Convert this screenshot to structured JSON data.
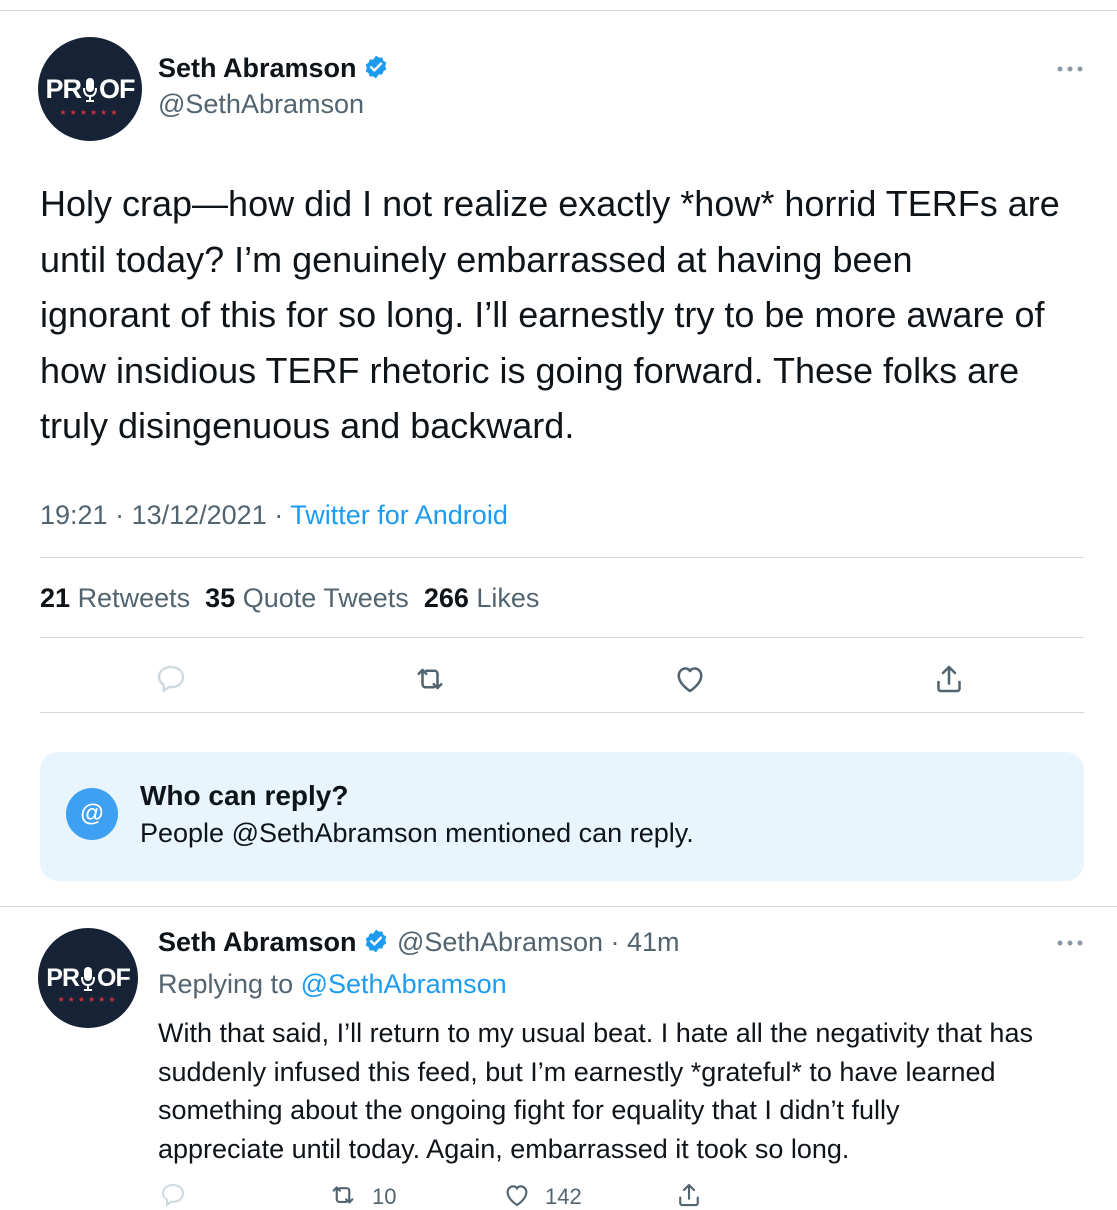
{
  "tweet": {
    "avatar_text": "PR  OF",
    "author_name": "Seth Abramson",
    "author_handle": "@SethAbramson",
    "body_lines": [
      "Holy crap—how did I not realize exactly *how* horrid TERFs are",
      "until today? I’m genuinely embarrassed at having been",
      "ignorant of this for so long. I’ll earnestly try to be more aware of",
      "how insidious TERF rhetoric is going forward. These folks are",
      "truly disingenuous and backward."
    ],
    "time": "19:21",
    "date": "13/12/2021",
    "source": "Twitter for Android",
    "stats": {
      "retweets_count": "21",
      "retweets_label": "Retweets",
      "quotes_count": "35",
      "quotes_label": "Quote Tweets",
      "likes_count": "266",
      "likes_label": "Likes"
    },
    "actions": [
      "reply-icon",
      "retweet-icon",
      "like-icon",
      "share-icon"
    ]
  },
  "reply_settings": {
    "icon": "@",
    "title": "Who can reply?",
    "description": "People @SethAbramson mentioned can reply."
  },
  "reply": {
    "author_name": "Seth Abramson",
    "author_handle": "@SethAbramson",
    "age": "41m",
    "replying_to_label": "Replying to",
    "replying_to_handle": "@SethAbramson",
    "body_lines": [
      "With that said, I’ll return to my usual beat. I hate all the negativity that has",
      "suddenly infused this feed, but I’m earnestly *grateful* to have learned",
      "something about the ongoing fight for equality that I didn’t fully",
      "appreciate until today. Again, embarrassed it took so long."
    ],
    "retweet_count": "10",
    "like_count": "142"
  },
  "colors": {
    "accent": "#1d9bf0",
    "secondary_text": "#536471",
    "divider": "#cfd9de",
    "avatar_bg": "#162235"
  }
}
